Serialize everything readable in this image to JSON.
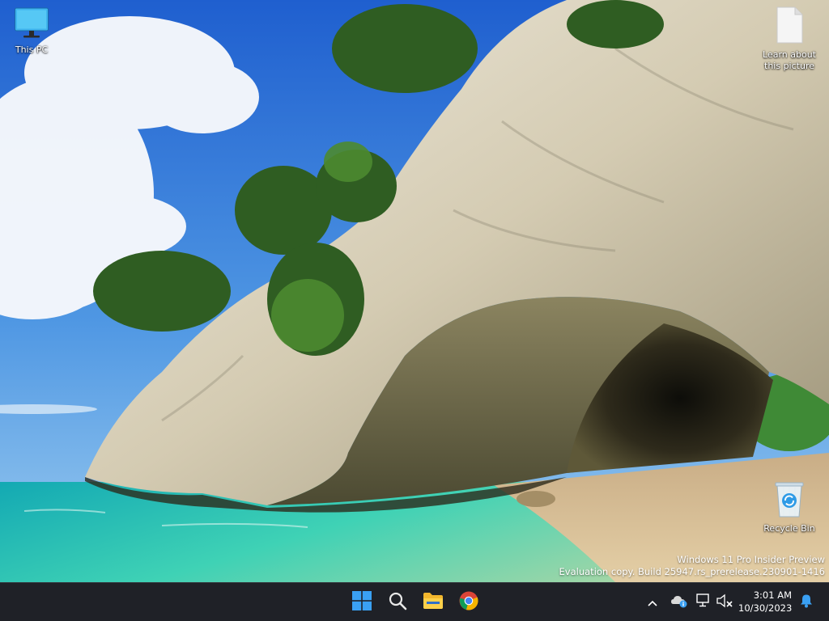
{
  "desktop": {
    "icons": [
      {
        "label": "This PC",
        "icon": "monitor-icon"
      },
      {
        "label": "Learn about this picture",
        "icon": "document-icon"
      },
      {
        "label": "Recycle Bin",
        "icon": "recycle-bin-icon"
      }
    ],
    "watermark": {
      "line1": "Windows 11 Pro Insider Preview",
      "line2": "Evaluation copy. Build 25947.rs_prerelease.230901-1416"
    }
  },
  "taskbar": {
    "apps": [
      {
        "name": "Start",
        "icon": "windows-logo-icon"
      },
      {
        "name": "Search",
        "icon": "search-icon"
      },
      {
        "name": "File Explorer",
        "icon": "folder-icon"
      },
      {
        "name": "Google Chrome",
        "icon": "chrome-icon"
      }
    ],
    "tray": {
      "time": "3:01 AM",
      "date": "10/30/2023",
      "icons": [
        "chevron-up-icon",
        "onedrive-icon",
        "network-icon",
        "volume-muted-icon",
        "notification-bell-icon"
      ]
    }
  },
  "colors": {
    "taskbar_bg": "#1f2127",
    "accent": "#3aa0f3",
    "sky": "#3b8be0",
    "water": "#2bc4b4"
  }
}
